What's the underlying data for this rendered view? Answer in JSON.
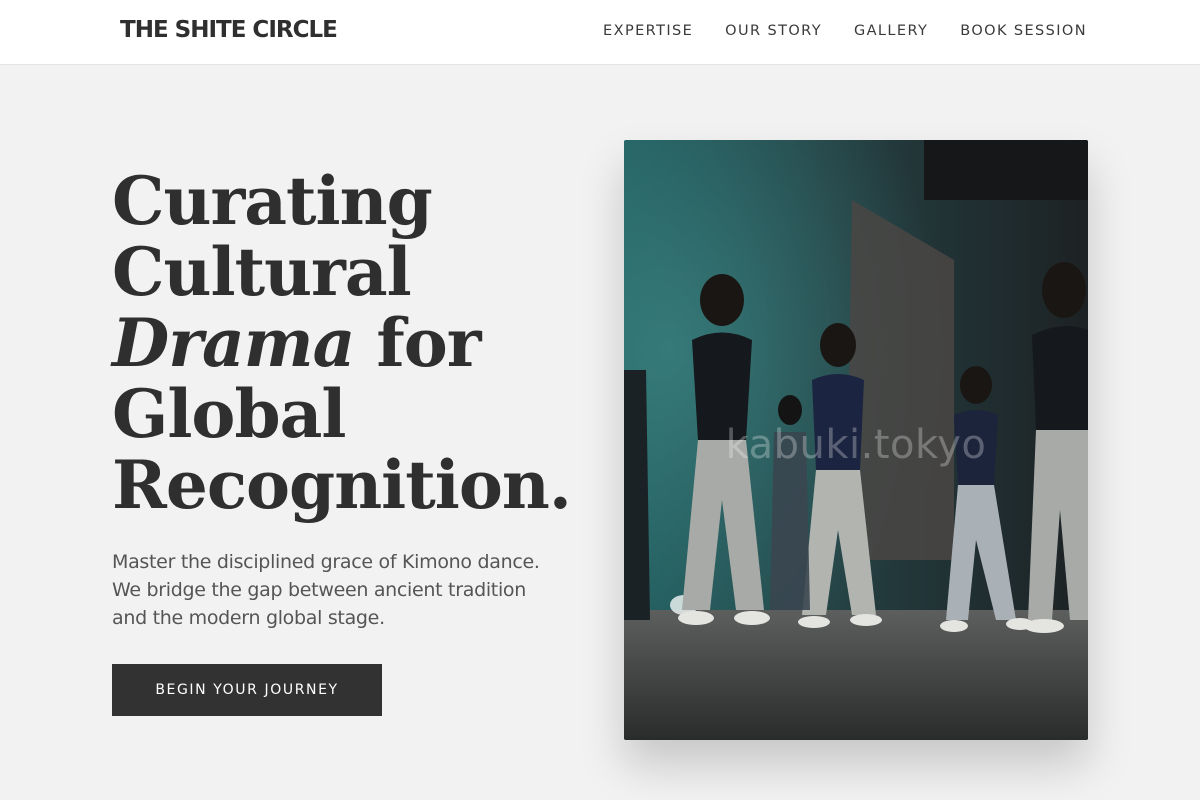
{
  "header": {
    "brand": "THE SHITE CIRCLE",
    "nav": [
      "EXPERTISE",
      "OUR STORY",
      "GALLERY",
      "BOOK SESSION"
    ]
  },
  "hero": {
    "title_lines": [
      "Curating",
      "Cultural",
      "Drama",
      " for",
      "Global",
      "Recognition."
    ],
    "text_lines": [
      "Master the disciplined grace of Kimono dance.",
      "We bridge the gap between ancient tradition",
      "and the modern global stage."
    ],
    "cta_label": "BEGIN YOUR JOURNEY",
    "image_watermark": "kabuki.tokyo"
  },
  "colors": {
    "background": "#f2f2f2",
    "header_bg": "#ffffff",
    "text_dark": "#2f2f2f",
    "text_body": "#555555",
    "button_bg": "#323232",
    "button_text": "#ffffff"
  }
}
